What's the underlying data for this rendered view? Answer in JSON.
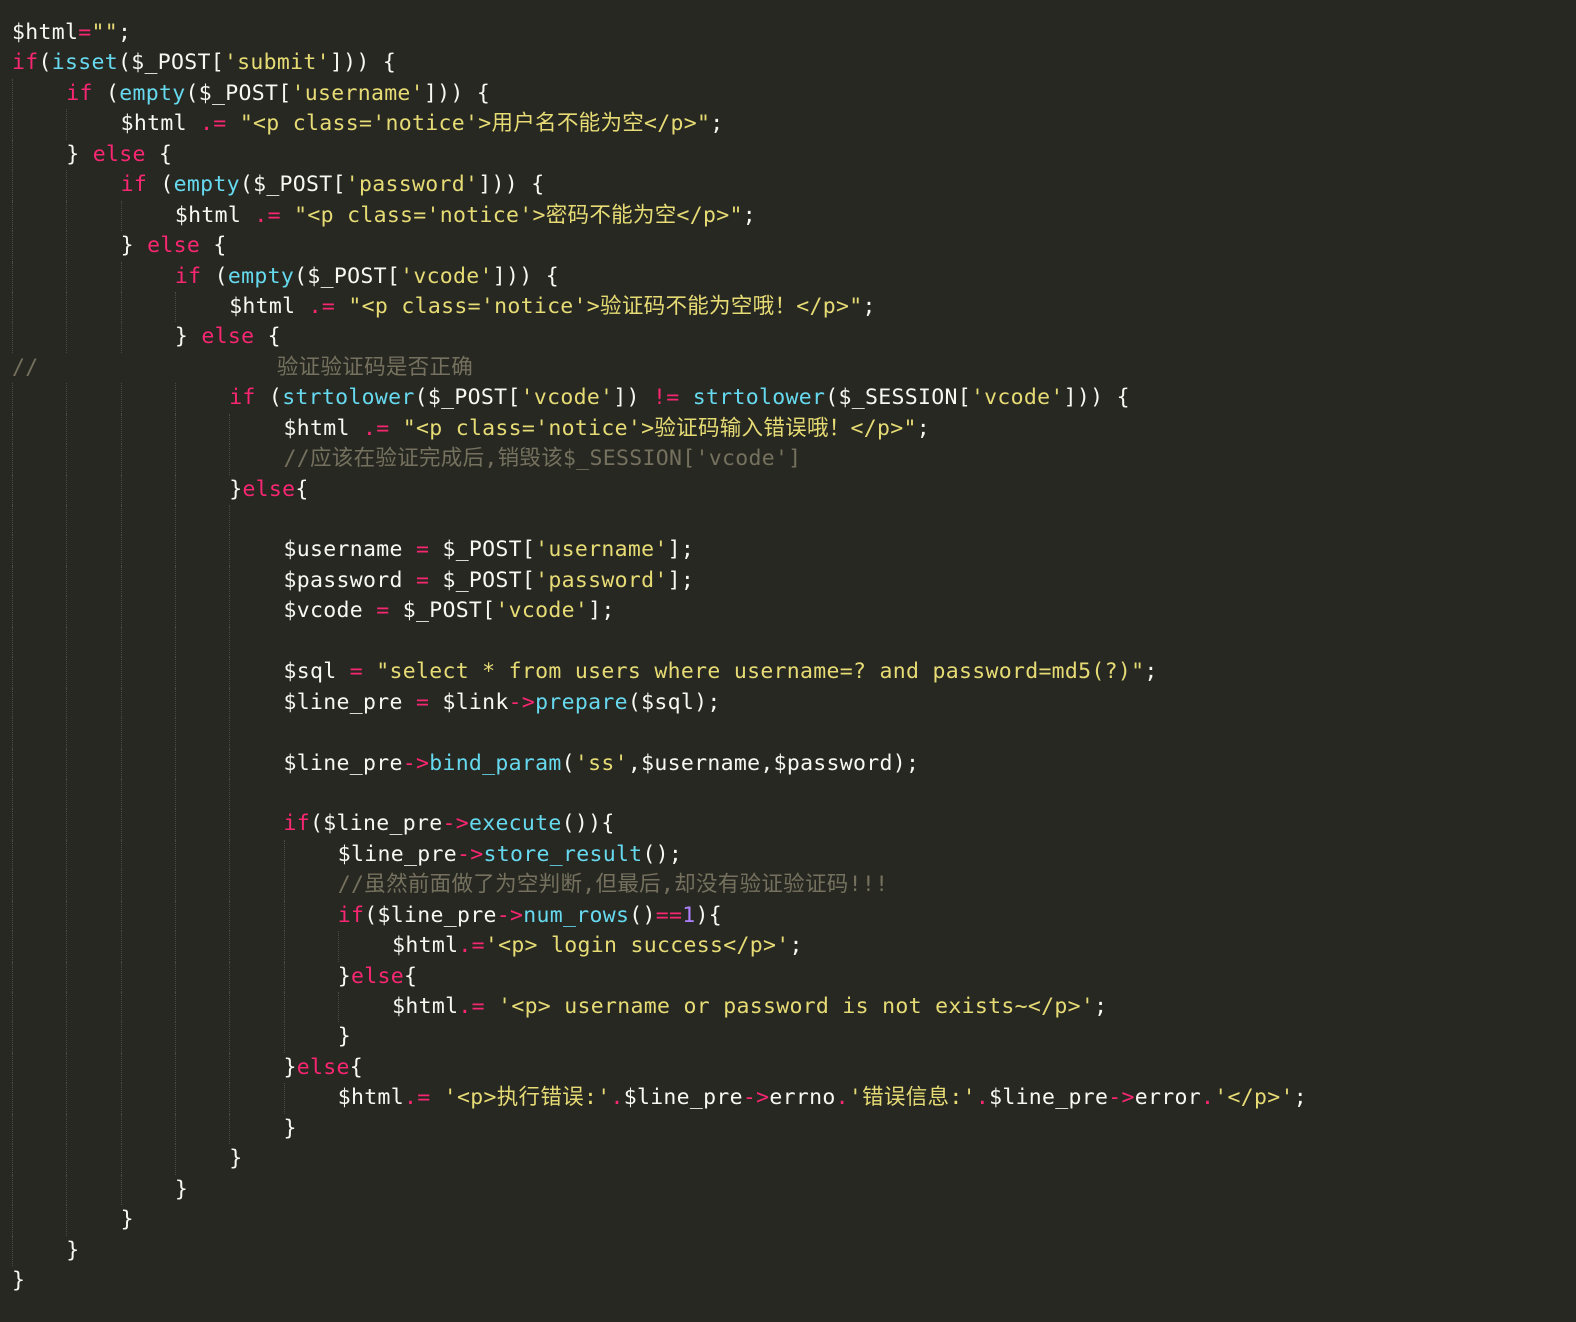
{
  "editor": {
    "theme": "monokai",
    "colors": {
      "background": "#272822",
      "plain": "#f8f8f2",
      "keyword": "#f92672",
      "operator": "#f92672",
      "function": "#66d9ef",
      "string": "#e6db74",
      "number": "#ae81ff",
      "comment": "#75715e",
      "indent_guide": "#4a4b44"
    },
    "lines": [
      {
        "indent": 0,
        "tokens": [
          [
            "plain",
            "$html"
          ],
          [
            "op",
            "="
          ],
          [
            "str",
            "\"\""
          ],
          [
            "plain",
            ";"
          ]
        ]
      },
      {
        "indent": 0,
        "tokens": [
          [
            "kw",
            "if"
          ],
          [
            "plain",
            "("
          ],
          [
            "fn",
            "isset"
          ],
          [
            "plain",
            "($_POST["
          ],
          [
            "str",
            "'submit'"
          ],
          [
            "plain",
            "])) {"
          ]
        ]
      },
      {
        "indent": 1,
        "tokens": [
          [
            "kw",
            "if"
          ],
          [
            "plain",
            " ("
          ],
          [
            "fn",
            "empty"
          ],
          [
            "plain",
            "($_POST["
          ],
          [
            "str",
            "'username'"
          ],
          [
            "plain",
            "])) {"
          ]
        ]
      },
      {
        "indent": 2,
        "tokens": [
          [
            "plain",
            "$html "
          ],
          [
            "op",
            ".="
          ],
          [
            "plain",
            " "
          ],
          [
            "str",
            "\"<p class='notice'>用户名不能为空</p>\""
          ],
          [
            "plain",
            ";"
          ]
        ]
      },
      {
        "indent": 1,
        "tokens": [
          [
            "plain",
            "} "
          ],
          [
            "kw",
            "else"
          ],
          [
            "plain",
            " {"
          ]
        ]
      },
      {
        "indent": 2,
        "tokens": [
          [
            "kw",
            "if"
          ],
          [
            "plain",
            " ("
          ],
          [
            "fn",
            "empty"
          ],
          [
            "plain",
            "($_POST["
          ],
          [
            "str",
            "'password'"
          ],
          [
            "plain",
            "])) {"
          ]
        ]
      },
      {
        "indent": 3,
        "tokens": [
          [
            "plain",
            "$html "
          ],
          [
            "op",
            ".="
          ],
          [
            "plain",
            " "
          ],
          [
            "str",
            "\"<p class='notice'>密码不能为空</p>\""
          ],
          [
            "plain",
            ";"
          ]
        ]
      },
      {
        "indent": 2,
        "tokens": [
          [
            "plain",
            "} "
          ],
          [
            "kw",
            "else"
          ],
          [
            "plain",
            " {"
          ]
        ]
      },
      {
        "indent": 3,
        "tokens": [
          [
            "kw",
            "if"
          ],
          [
            "plain",
            " ("
          ],
          [
            "fn",
            "empty"
          ],
          [
            "plain",
            "($_POST["
          ],
          [
            "str",
            "'vcode'"
          ],
          [
            "plain",
            "])) {"
          ]
        ]
      },
      {
        "indent": 4,
        "tokens": [
          [
            "plain",
            "$html "
          ],
          [
            "op",
            ".="
          ],
          [
            "plain",
            " "
          ],
          [
            "str",
            "\"<p class='notice'>验证码不能为空哦！</p>\""
          ],
          [
            "plain",
            ";"
          ]
        ]
      },
      {
        "indent": 3,
        "tokens": [
          [
            "plain",
            "} "
          ],
          [
            "kw",
            "else"
          ],
          [
            "plain",
            " {"
          ]
        ]
      },
      {
        "indent": 0,
        "tokens": [
          [
            "cm",
            "//                  验证验证码是否正确"
          ]
        ]
      },
      {
        "indent": 4,
        "tokens": [
          [
            "kw",
            "if"
          ],
          [
            "plain",
            " ("
          ],
          [
            "fn",
            "strtolower"
          ],
          [
            "plain",
            "($_POST["
          ],
          [
            "str",
            "'vcode'"
          ],
          [
            "plain",
            "]) "
          ],
          [
            "op",
            "!="
          ],
          [
            "plain",
            " "
          ],
          [
            "fn",
            "strtolower"
          ],
          [
            "plain",
            "($_SESSION["
          ],
          [
            "str",
            "'vcode'"
          ],
          [
            "plain",
            "])) {"
          ]
        ]
      },
      {
        "indent": 5,
        "tokens": [
          [
            "plain",
            "$html "
          ],
          [
            "op",
            ".="
          ],
          [
            "plain",
            " "
          ],
          [
            "str",
            "\"<p class='notice'>验证码输入错误哦！</p>\""
          ],
          [
            "plain",
            ";"
          ]
        ]
      },
      {
        "indent": 5,
        "tokens": [
          [
            "cm",
            "//应该在验证完成后,销毁该$_SESSION['vcode']"
          ]
        ]
      },
      {
        "indent": 4,
        "tokens": [
          [
            "plain",
            "}"
          ],
          [
            "kw",
            "else"
          ],
          [
            "plain",
            "{"
          ]
        ]
      },
      {
        "indent": 5,
        "tokens": []
      },
      {
        "indent": 5,
        "tokens": [
          [
            "plain",
            "$username "
          ],
          [
            "op",
            "="
          ],
          [
            "plain",
            " $_POST["
          ],
          [
            "str",
            "'username'"
          ],
          [
            "plain",
            "];"
          ]
        ]
      },
      {
        "indent": 5,
        "tokens": [
          [
            "plain",
            "$password "
          ],
          [
            "op",
            "="
          ],
          [
            "plain",
            " $_POST["
          ],
          [
            "str",
            "'password'"
          ],
          [
            "plain",
            "];"
          ]
        ]
      },
      {
        "indent": 5,
        "tokens": [
          [
            "plain",
            "$vcode "
          ],
          [
            "op",
            "="
          ],
          [
            "plain",
            " $_POST["
          ],
          [
            "str",
            "'vcode'"
          ],
          [
            "plain",
            "];"
          ]
        ]
      },
      {
        "indent": 5,
        "tokens": []
      },
      {
        "indent": 5,
        "tokens": [
          [
            "plain",
            "$sql "
          ],
          [
            "op",
            "="
          ],
          [
            "plain",
            " "
          ],
          [
            "str",
            "\"select * from users where username=? and password=md5(?)\""
          ],
          [
            "plain",
            ";"
          ]
        ]
      },
      {
        "indent": 5,
        "tokens": [
          [
            "plain",
            "$line_pre "
          ],
          [
            "op",
            "="
          ],
          [
            "plain",
            " $link"
          ],
          [
            "op",
            "->"
          ],
          [
            "fn",
            "prepare"
          ],
          [
            "plain",
            "($sql);"
          ]
        ]
      },
      {
        "indent": 5,
        "tokens": []
      },
      {
        "indent": 5,
        "tokens": [
          [
            "plain",
            "$line_pre"
          ],
          [
            "op",
            "->"
          ],
          [
            "fn",
            "bind_param"
          ],
          [
            "plain",
            "("
          ],
          [
            "str",
            "'ss'"
          ],
          [
            "plain",
            ",$username,$password);"
          ]
        ]
      },
      {
        "indent": 5,
        "tokens": []
      },
      {
        "indent": 5,
        "tokens": [
          [
            "kw",
            "if"
          ],
          [
            "plain",
            "($line_pre"
          ],
          [
            "op",
            "->"
          ],
          [
            "fn",
            "execute"
          ],
          [
            "plain",
            "()){"
          ]
        ]
      },
      {
        "indent": 6,
        "tokens": [
          [
            "plain",
            "$line_pre"
          ],
          [
            "op",
            "->"
          ],
          [
            "fn",
            "store_result"
          ],
          [
            "plain",
            "();"
          ]
        ]
      },
      {
        "indent": 6,
        "tokens": [
          [
            "cm",
            "//虽然前面做了为空判断,但最后,却没有验证验证码!!!"
          ]
        ]
      },
      {
        "indent": 6,
        "tokens": [
          [
            "kw",
            "if"
          ],
          [
            "plain",
            "($line_pre"
          ],
          [
            "op",
            "->"
          ],
          [
            "fn",
            "num_rows"
          ],
          [
            "plain",
            "()"
          ],
          [
            "op",
            "=="
          ],
          [
            "num",
            "1"
          ],
          [
            "plain",
            "){"
          ]
        ]
      },
      {
        "indent": 7,
        "tokens": [
          [
            "plain",
            "$html"
          ],
          [
            "op",
            ".="
          ],
          [
            "str",
            "'<p> login success</p>'"
          ],
          [
            "plain",
            ";"
          ]
        ]
      },
      {
        "indent": 6,
        "tokens": [
          [
            "plain",
            "}"
          ],
          [
            "kw",
            "else"
          ],
          [
            "plain",
            "{"
          ]
        ]
      },
      {
        "indent": 7,
        "tokens": [
          [
            "plain",
            "$html"
          ],
          [
            "op",
            ".="
          ],
          [
            "plain",
            " "
          ],
          [
            "str",
            "'<p> username or password is not exists~</p>'"
          ],
          [
            "plain",
            ";"
          ]
        ]
      },
      {
        "indent": 6,
        "tokens": [
          [
            "plain",
            "}"
          ]
        ]
      },
      {
        "indent": 5,
        "tokens": [
          [
            "plain",
            "}"
          ],
          [
            "kw",
            "else"
          ],
          [
            "plain",
            "{"
          ]
        ]
      },
      {
        "indent": 6,
        "tokens": [
          [
            "plain",
            "$html"
          ],
          [
            "op",
            ".="
          ],
          [
            "plain",
            " "
          ],
          [
            "str",
            "'<p>执行错误:'"
          ],
          [
            "op",
            "."
          ],
          [
            "plain",
            "$line_pre"
          ],
          [
            "op",
            "->"
          ],
          [
            "plain",
            "errno"
          ],
          [
            "op",
            "."
          ],
          [
            "str",
            "'错误信息:'"
          ],
          [
            "op",
            "."
          ],
          [
            "plain",
            "$line_pre"
          ],
          [
            "op",
            "->"
          ],
          [
            "plain",
            "error"
          ],
          [
            "op",
            "."
          ],
          [
            "str",
            "'</p>'"
          ],
          [
            "plain",
            ";"
          ]
        ]
      },
      {
        "indent": 5,
        "tokens": [
          [
            "plain",
            "}"
          ]
        ]
      },
      {
        "indent": 4,
        "tokens": [
          [
            "plain",
            "}"
          ]
        ]
      },
      {
        "indent": 3,
        "tokens": [
          [
            "plain",
            "}"
          ]
        ]
      },
      {
        "indent": 2,
        "tokens": [
          [
            "plain",
            "}"
          ]
        ]
      },
      {
        "indent": 1,
        "tokens": [
          [
            "plain",
            "}"
          ]
        ]
      },
      {
        "indent": 0,
        "tokens": [
          [
            "plain",
            "}"
          ]
        ]
      }
    ]
  }
}
